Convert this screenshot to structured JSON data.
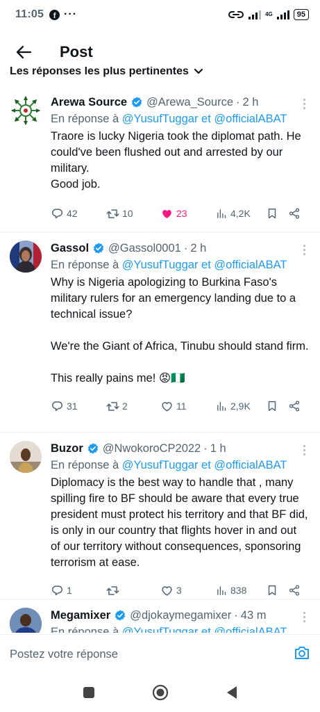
{
  "status_bar": {
    "time": "11:05",
    "facebook_glyph": "f",
    "dots": "···",
    "network": "4G",
    "battery": "95"
  },
  "header": {
    "title": "Post"
  },
  "sort": {
    "label": "Les réponses les plus pertinentes"
  },
  "tweets": [
    {
      "name": "Arewa Source",
      "handle": "@Arewa_Source",
      "sep": "·",
      "time": "2 h",
      "reply_prefix": "En réponse à",
      "mention_1": "@YusufTuggar",
      "joiner": "et",
      "mention_2": "@officialABAT",
      "text": "Traore is lucky Nigeria took the diplomat path. He could've been flushed out and arrested by our military.\nGood job.",
      "replies": "42",
      "retweets": "10",
      "likes": "23",
      "views": "4,2K",
      "liked": true
    },
    {
      "name": "Gassol",
      "handle": "@Gassol0001",
      "sep": "·",
      "time": "2 h",
      "reply_prefix": "En réponse à",
      "mention_1": "@YusufTuggar",
      "joiner": "et",
      "mention_2": "@officialABAT",
      "text": "Why is Nigeria apologizing to Burkina Faso's military rulers for an emergency landing due to a technical issue?\n\nWe're the Giant of Africa, Tinubu should stand firm.\n\nThis really pains me! 😡🇳🇬",
      "replies": "31",
      "retweets": "2",
      "likes": "11",
      "views": "2,9K",
      "liked": false
    },
    {
      "name": "Buzor",
      "handle": "@NwokoroCP2022",
      "sep": "·",
      "time": "1 h",
      "reply_prefix": "En réponse à",
      "mention_1": "@YusufTuggar",
      "joiner": "et",
      "mention_2": "@officialABAT",
      "text": "Diplomacy is the best way to handle that , many spilling fire to BF should be aware that every true president must protect his territory and that BF did, is only in our country that flights hover in and out of our territory without consequences, sponsoring terrorism at ease.",
      "replies": "1",
      "retweets": "",
      "likes": "3",
      "views": "838",
      "liked": false
    },
    {
      "name": "Megamixer",
      "handle": "@djokaymegamixer",
      "sep": "·",
      "time": "43 m",
      "reply_prefix": "En réponse à",
      "mention_1": "@YusufTuggar",
      "joiner": "et",
      "mention_2": "@officialABAT"
    }
  ],
  "composer": {
    "placeholder": "Postez votre réponse"
  },
  "colors": {
    "accent": "#1d9bf0",
    "like": "#f91880",
    "secondary_text": "#536471",
    "divider": "#eff3f4"
  },
  "icons": [
    "back-arrow-icon",
    "chevron-down-icon",
    "verified-badge-icon",
    "more-icon",
    "reply-icon",
    "retweet-icon",
    "like-icon",
    "views-icon",
    "bookmark-icon",
    "share-icon",
    "camera-icon",
    "nav-recents-icon",
    "nav-home-icon",
    "nav-back-icon"
  ]
}
